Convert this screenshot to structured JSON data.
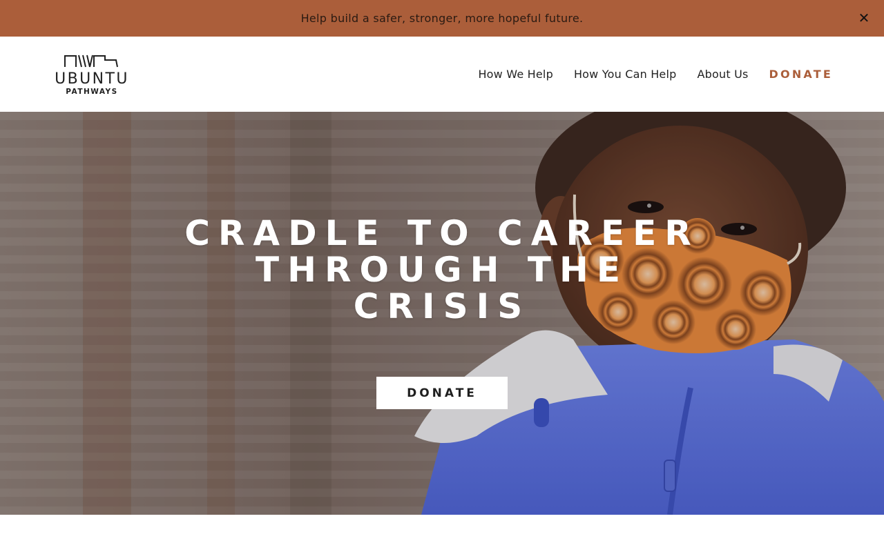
{
  "announcement": {
    "text": "Help build a safer, stronger, more hopeful future.",
    "close_icon": "close-icon",
    "close_glyph": "✕",
    "background": "#ab5e3a"
  },
  "brand": {
    "name": "UBUNTU",
    "tagline": "PATHWAYS"
  },
  "nav": {
    "items": [
      {
        "label": "How We Help"
      },
      {
        "label": "How You Can Help"
      },
      {
        "label": "About Us"
      }
    ],
    "donate_label": "DONATE",
    "accent": "#ab5e3a"
  },
  "hero": {
    "title_lines": [
      "CRADLE TO CAREER",
      "THROUGH THE",
      "CRISIS"
    ],
    "donate_label": "DONATE"
  }
}
